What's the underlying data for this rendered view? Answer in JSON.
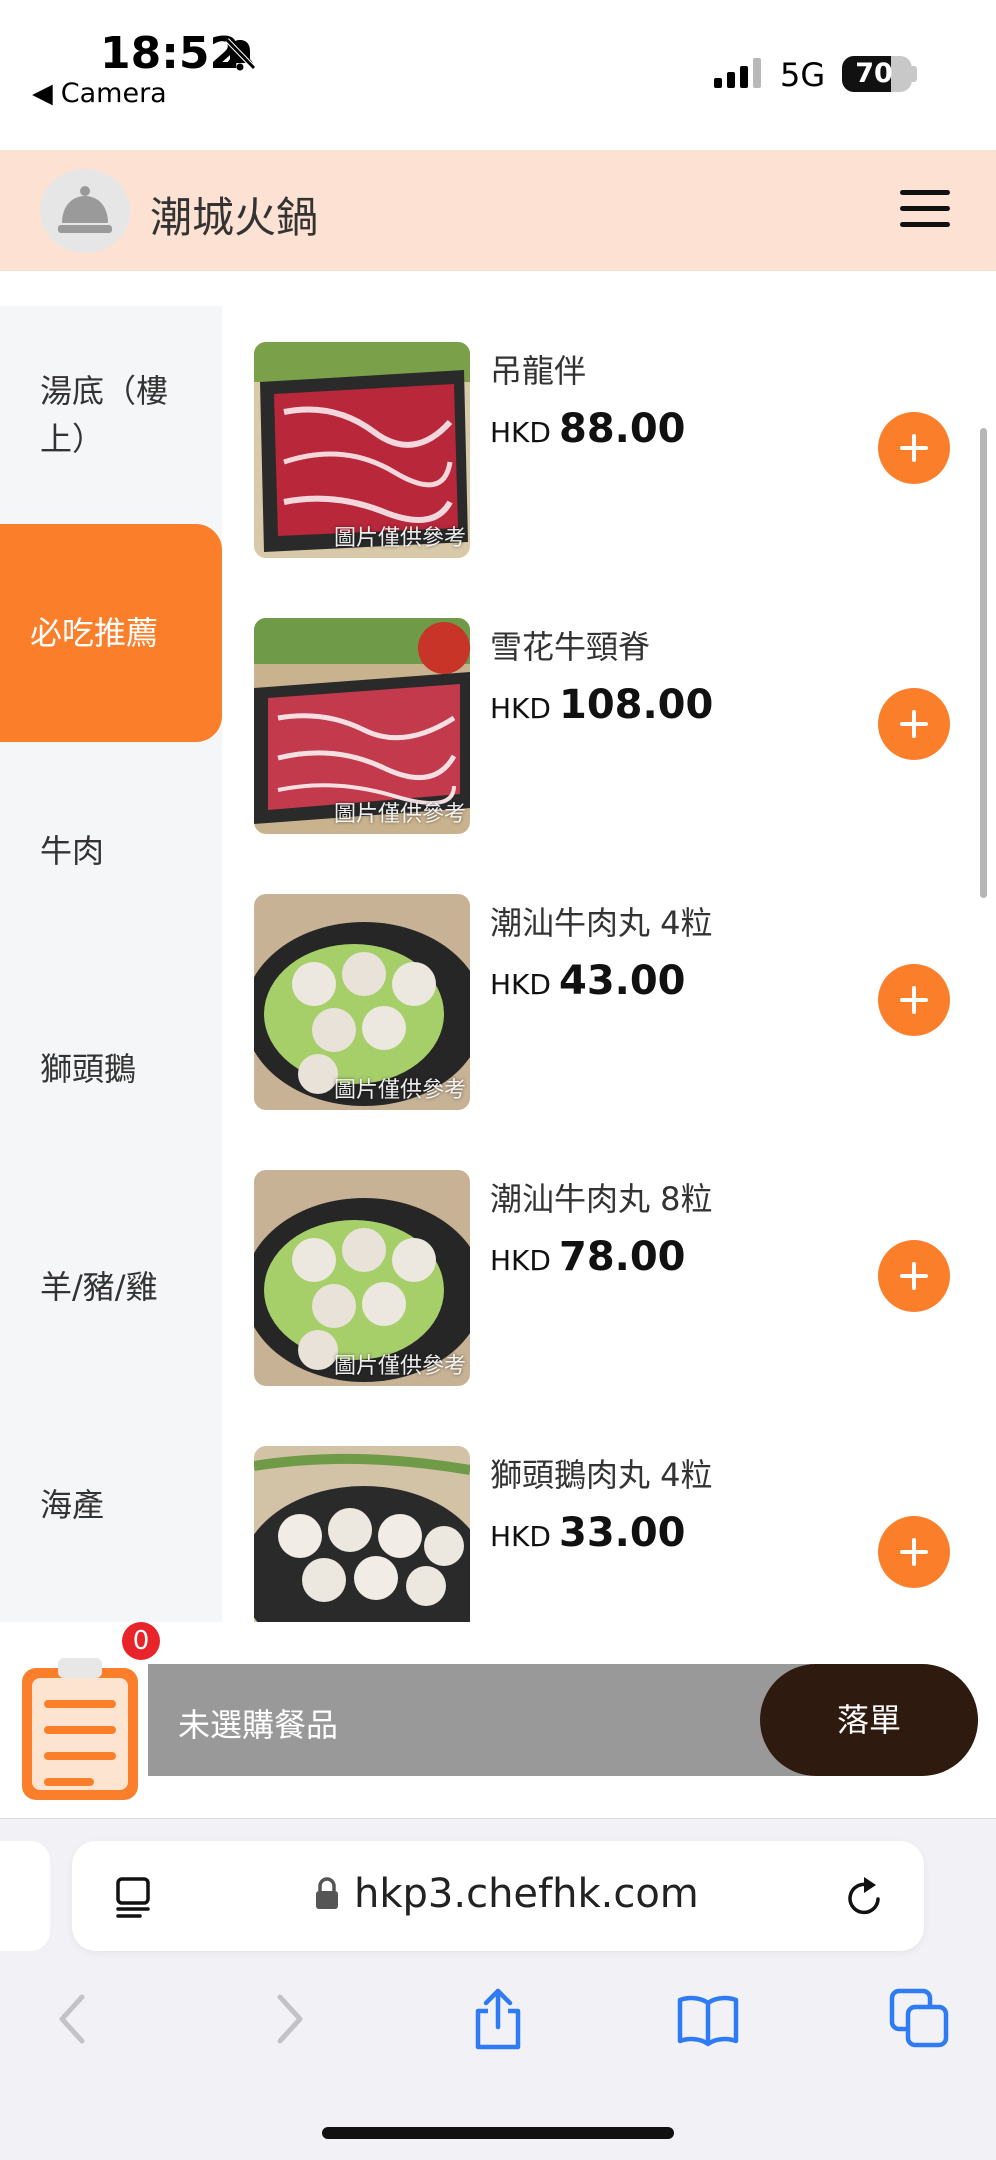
{
  "status_bar": {
    "time": "18:52",
    "back_label": "Camera",
    "network": "5G",
    "battery": "70",
    "battery_level": 0.7
  },
  "header": {
    "title": "潮城火鍋",
    "logo_icon": "service-bell-icon",
    "menu_icon": "hamburger-menu-icon"
  },
  "sidebar": {
    "items": [
      {
        "label": "湯底（樓上）",
        "active": false
      },
      {
        "label": "必吃推薦",
        "active": true
      },
      {
        "label": "牛肉",
        "active": false
      },
      {
        "label": "獅頭鵝",
        "active": false
      },
      {
        "label": "羊/豬/雞",
        "active": false
      },
      {
        "label": "海產",
        "active": false
      }
    ]
  },
  "products": {
    "image_caption": "圖片僅供參考",
    "items": [
      {
        "name": "吊龍伴",
        "currency": "HKD",
        "price": "88.00",
        "image": "sliced-beef"
      },
      {
        "name": "雪花牛頸脊",
        "currency": "HKD",
        "price": "108.00",
        "image": "marbled-beef"
      },
      {
        "name": "潮汕牛肉丸 4粒",
        "currency": "HKD",
        "price": "43.00",
        "image": "beef-balls"
      },
      {
        "name": "潮汕牛肉丸 8粒",
        "currency": "HKD",
        "price": "78.00",
        "image": "beef-balls"
      },
      {
        "name": "獅頭鵝肉丸 4粒",
        "currency": "HKD",
        "price": "33.00",
        "image": "goose-meatballs"
      }
    ]
  },
  "cart": {
    "count": "0",
    "empty_text": "未選購餐品",
    "order_label": "落單"
  },
  "browser": {
    "url": "hkp3.chefhk.com"
  },
  "colors": {
    "accent": "#fb7f2a",
    "header_bg": "#fde2d3",
    "order_button": "#2f1a0f",
    "badge": "#e8232a"
  }
}
